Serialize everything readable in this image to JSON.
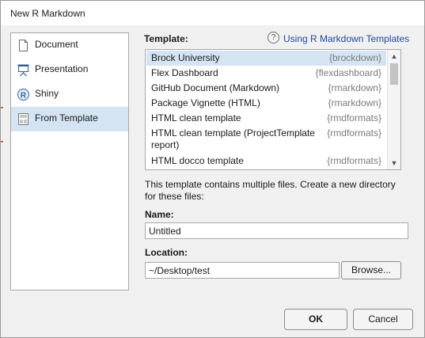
{
  "window": {
    "title": "New R Markdown"
  },
  "sidebar": {
    "items": [
      {
        "label": "Document",
        "icon": "document-icon",
        "selected": false
      },
      {
        "label": "Presentation",
        "icon": "presentation-icon",
        "selected": false
      },
      {
        "label": "Shiny",
        "icon": "shiny-icon",
        "selected": false
      },
      {
        "label": "From Template",
        "icon": "template-icon",
        "selected": true
      }
    ]
  },
  "templates": {
    "label": "Template:",
    "help_link": "Using R Markdown Templates",
    "help_icon": "question-icon",
    "items": [
      {
        "name": "Brock University",
        "package": "{brockdown}",
        "selected": true
      },
      {
        "name": "Flex Dashboard",
        "package": "{flexdashboard}",
        "selected": false
      },
      {
        "name": "GitHub Document (Markdown)",
        "package": "{rmarkdown}",
        "selected": false
      },
      {
        "name": "Package Vignette (HTML)",
        "package": "{rmarkdown}",
        "selected": false
      },
      {
        "name": "HTML clean template",
        "package": "{rmdformats}",
        "selected": false
      },
      {
        "name": "HTML clean template (ProjectTemplate report)",
        "package": "{rmdformats}",
        "selected": false
      },
      {
        "name": "HTML docco template",
        "package": "{rmdformats}",
        "selected": false
      }
    ]
  },
  "description": "This template contains multiple files. Create a new directory for these files:",
  "name_field": {
    "label": "Name:",
    "value": "Untitled"
  },
  "location_field": {
    "label": "Location:",
    "value": "~/Desktop/test"
  },
  "buttons": {
    "browse": "Browse...",
    "ok": "OK",
    "cancel": "Cancel"
  },
  "colors": {
    "selection": "#d4e4f2",
    "link": "#1e4aa0",
    "package_text": "#7a7a7a",
    "dialog_bg": "#f0f0f0"
  }
}
